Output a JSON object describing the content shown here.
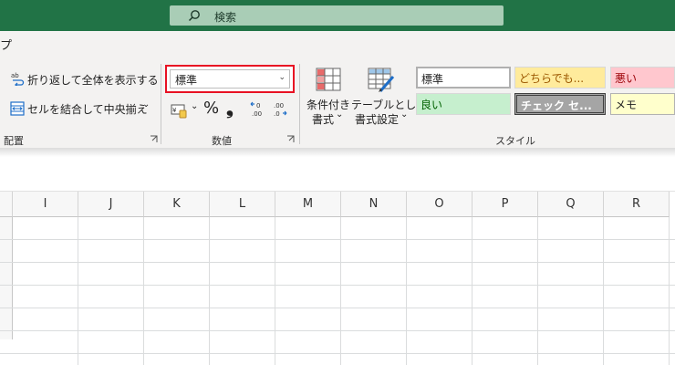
{
  "search": {
    "placeholder": "検索"
  },
  "tabs": {
    "partial_tab": "プ"
  },
  "alignment": {
    "wrap_text_label": "折り返して全体を表示する",
    "merge_center_label": "セルを結合して中央揃え",
    "group_label": "配置"
  },
  "number": {
    "format_value": "標準",
    "group_label": "数値"
  },
  "styles": {
    "conditional_format_line1": "条件付き",
    "conditional_format_line2": "書式",
    "format_table_line1": "テーブルとして",
    "format_table_line2": "書式設定",
    "group_label": "スタイル",
    "cells": [
      {
        "label": "標準",
        "bg": "#ffffff",
        "fg": "#222222"
      },
      {
        "label": "どちらでも...",
        "bg": "#ffeb9c",
        "fg": "#9c5700"
      },
      {
        "label": "悪い",
        "bg": "#ffc7ce",
        "fg": "#9c0006"
      },
      {
        "label": "良い",
        "bg": "#c6efce",
        "fg": "#006100"
      },
      {
        "label": "チェック セ...",
        "bg": "#a5a5a5",
        "fg": "#ffffff"
      },
      {
        "label": "メモ",
        "bg": "#ffffcc",
        "fg": "#222222"
      }
    ]
  },
  "columns": [
    "I",
    "J",
    "K",
    "L",
    "M",
    "N",
    "O",
    "P",
    "Q",
    "R"
  ],
  "colors": {
    "titlebar": "#217346",
    "highlight": "#e81123"
  }
}
